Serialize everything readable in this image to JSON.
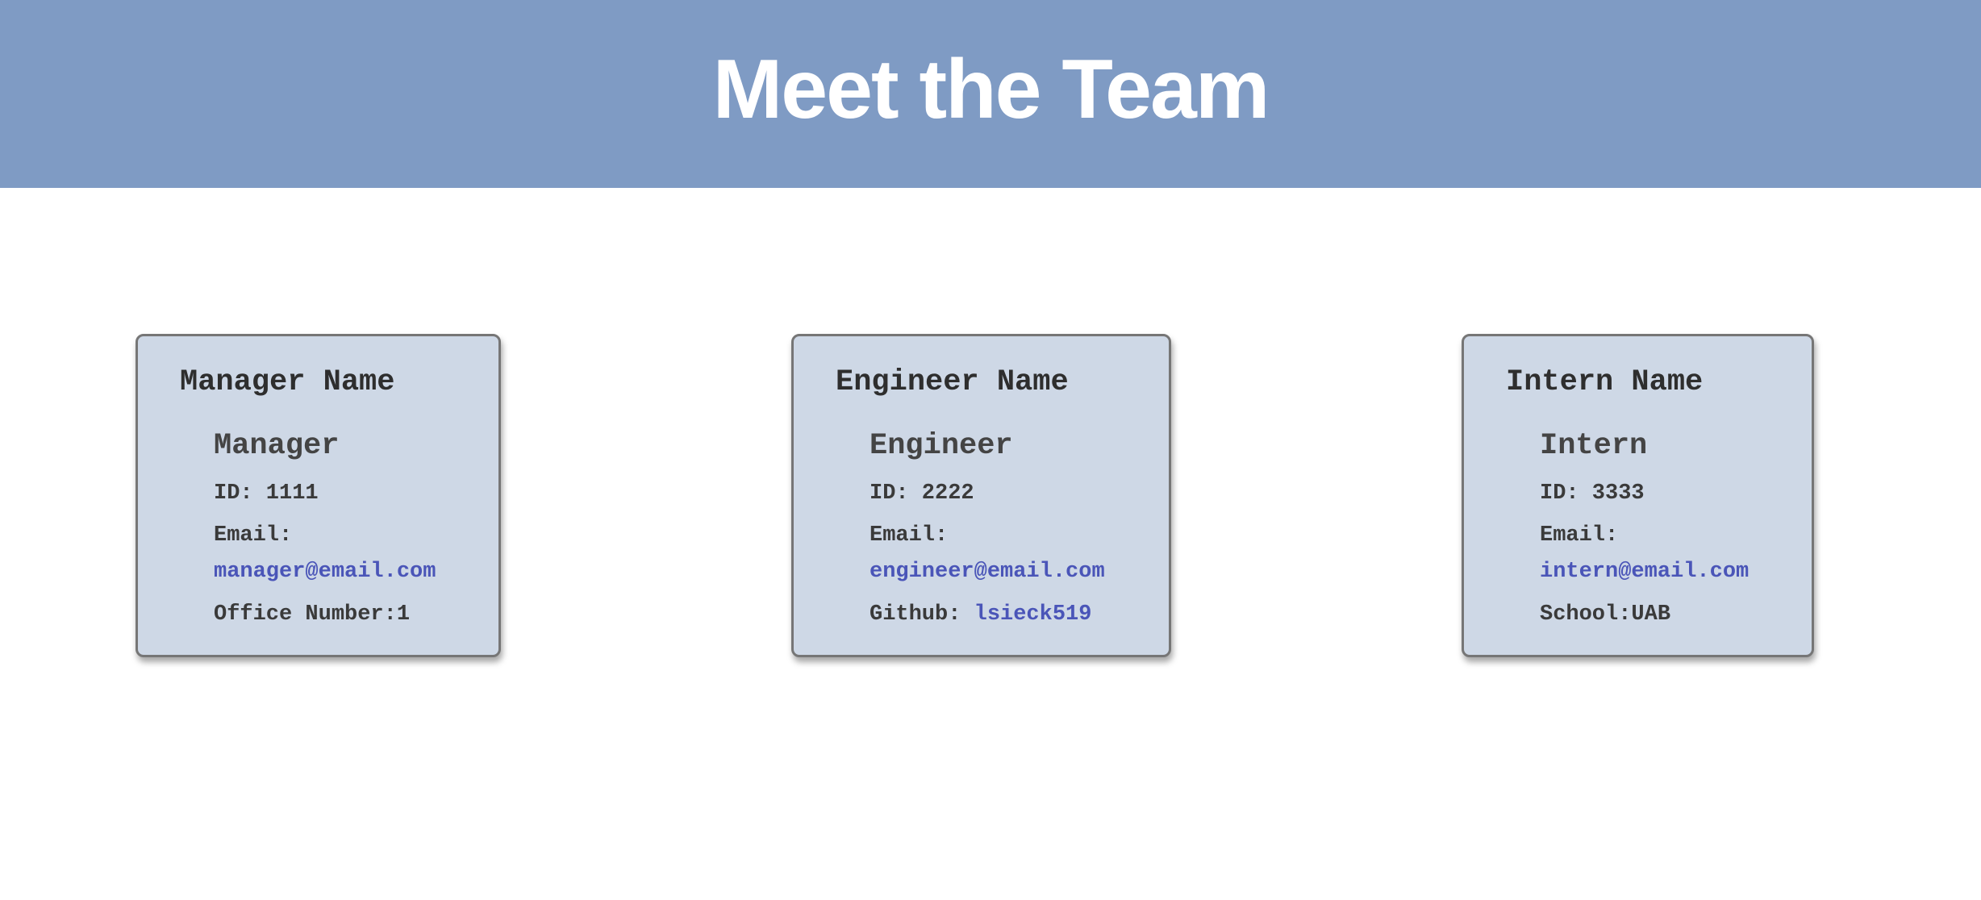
{
  "header": {
    "title": "Meet the Team"
  },
  "colors": {
    "header_bg": "#7f9bc4",
    "card_bg": "#ced8e6",
    "link": "#4a55b8"
  },
  "cards": [
    {
      "name": "Manager Name",
      "role": "Manager",
      "id_label": "ID: 1111",
      "email_label": "Email:",
      "email": "manager@email.com",
      "extra_label": "Office Number:1",
      "extra_link": ""
    },
    {
      "name": "Engineer Name",
      "role": "Engineer",
      "id_label": "ID: 2222",
      "email_label": "Email:",
      "email": "engineer@email.com",
      "extra_label": "Github:",
      "extra_link": "lsieck519"
    },
    {
      "name": "Intern Name",
      "role": "Intern",
      "id_label": "ID: 3333",
      "email_label": "Email:",
      "email": "intern@email.com",
      "extra_label": "School:UAB",
      "extra_link": ""
    }
  ]
}
